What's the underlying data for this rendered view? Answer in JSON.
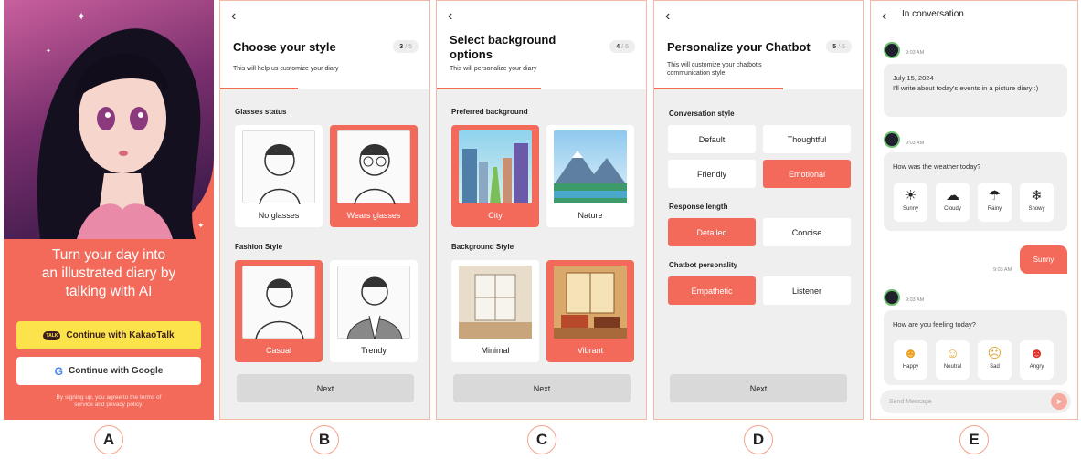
{
  "panel_a": {
    "headline": "Turn your day into\nan illustrated diary by\ntalking with AI",
    "kakao_button": "Continue with KakaoTalk",
    "google_button": "Continue with Google",
    "terms": "By signing up, you agree to the terms of\nservice and privacy policy.",
    "kakao_icon": "TALK",
    "google_icon": "G"
  },
  "panel_b": {
    "title": "Choose your style",
    "step": "3",
    "total": "/ 5",
    "subtitle": "This will help us customize your diary",
    "progress_fraction": 0.6,
    "section1": "Glasses status",
    "section2": "Fashion Style",
    "options1": [
      "No glasses",
      "Wears glasses"
    ],
    "options2": [
      "Casual",
      "Trendy"
    ],
    "next": "Next"
  },
  "panel_c": {
    "title": "Select background\noptions",
    "step": "4",
    "total": "/ 5",
    "subtitle": "This will personalize your diary",
    "progress_fraction": 0.8,
    "section1": "Preferred background",
    "section2": "Background Style",
    "options1": [
      "City",
      "Nature"
    ],
    "options2": [
      "Minimal",
      "Vibrant"
    ],
    "next": "Next"
  },
  "panel_d": {
    "title": "Personalize your Chatbot",
    "step": "5",
    "total": "/ 5",
    "subtitle": "This will customize your chatbot's\ncommunication style",
    "progress_fraction": 1.0,
    "section1": "Conversation style",
    "section2": "Response length",
    "section3": "Chatbot personality",
    "conversation": [
      "Default",
      "Thoughtful",
      "Friendly",
      "Emotional"
    ],
    "length": [
      "Detailed",
      "Concise"
    ],
    "personality": [
      "Empathetic",
      "Listener"
    ],
    "next": "Next"
  },
  "panel_e": {
    "title": "In conversation",
    "time1": "9:03 AM",
    "msg1": "July 15, 2024\nI'll write about today's events in a picture diary :)",
    "time2": "9:03 AM",
    "msg2": "How was the weather today?",
    "weather": [
      "Sunny",
      "Cloudy",
      "Rainy",
      "Snowy"
    ],
    "reply": "Sunny",
    "time_reply": "9:03 AM",
    "time3": "9:03 AM",
    "msg3": "How are you feeling today?",
    "feelings": [
      "Happy",
      "Neutral",
      "Sad",
      "Angry"
    ],
    "composer_placeholder": "Send Message"
  },
  "letters": [
    "A",
    "B",
    "C",
    "D",
    "E"
  ],
  "colors": {
    "accent": "#f36a5a",
    "kakao": "#fce34b",
    "border": "#f3b9a6"
  }
}
